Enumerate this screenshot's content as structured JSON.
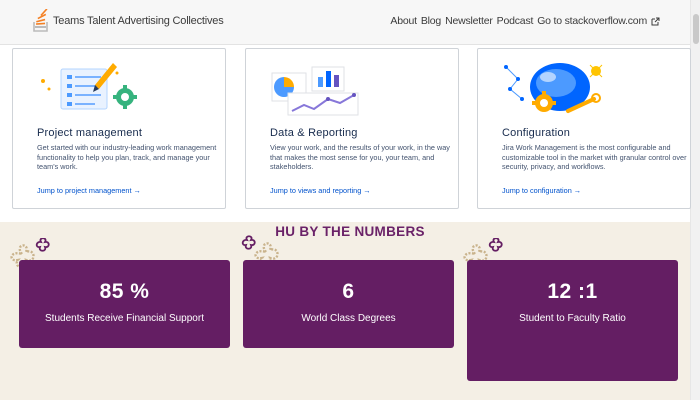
{
  "header": {
    "brand": "Teams Talent Advertising Collectives",
    "nav": [
      "About",
      "Blog",
      "Newsletter",
      "Podcast",
      "Go to stackoverflow.com"
    ],
    "external_icon": "external-link-icon",
    "logo_icon": "stack-logo-icon"
  },
  "cards": [
    {
      "title": "Project management",
      "text": "Get started with our industry-leading work management functionality to help you plan, track, and manage your team's work.",
      "link": "Jump to project management →",
      "icon": "checklist-pencil-gear-icon"
    },
    {
      "title": "Data & Reporting",
      "text": "View your work, and the results of your work, in the way that makes the most sense for you, your team, and stakeholders.",
      "link": "Jump to views and reporting →",
      "icon": "charts-icon"
    },
    {
      "title": "Configuration",
      "text": "Jira Work Management is the most configurable and customizable tool in the market with granular control over security, privacy, and workflows.",
      "link": "Jump to configuration →",
      "icon": "gear-wrench-globe-icon"
    }
  ],
  "numbers": {
    "title": "HU BY THE NUMBERS",
    "stats": [
      {
        "value": "85 %",
        "label": "Students Receive Financial Support"
      },
      {
        "value": "6",
        "label": "World Class Degrees"
      },
      {
        "value": "12 :1",
        "label": "Student to Faculty Ratio"
      }
    ]
  },
  "colors": {
    "accent_purple": "#641e63",
    "link_blue": "#0052cc",
    "section_bg": "#f4efe5"
  }
}
